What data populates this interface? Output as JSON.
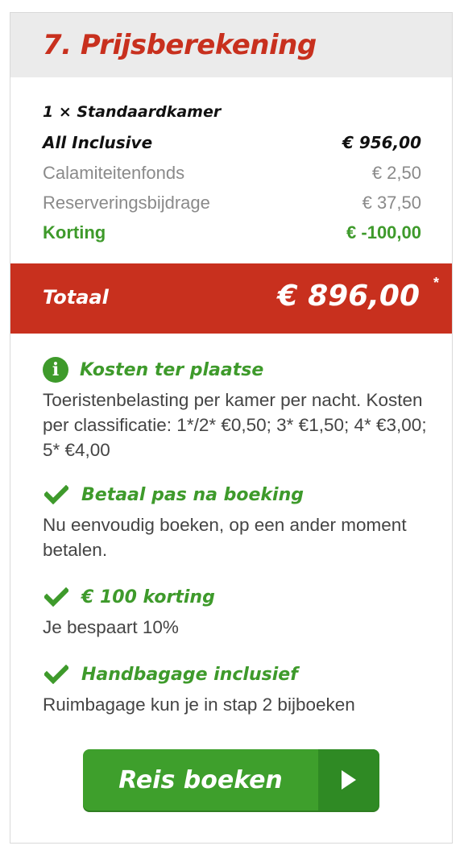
{
  "header": {
    "title": "7. Prijsberekening"
  },
  "price_lines": {
    "room": {
      "label": "1 × Standaardkamer"
    },
    "board": {
      "label": "All Inclusive",
      "value": "€ 956,00"
    },
    "fund": {
      "label": "Calamiteitenfonds",
      "value": "€ 2,50"
    },
    "reservation": {
      "label": "Reserveringsbijdrage",
      "value": "€ 37,50"
    },
    "discount": {
      "label": "Korting",
      "value": "€ -100,00"
    }
  },
  "total": {
    "label": "Totaal",
    "value": "€ 896,00",
    "marker": "*"
  },
  "info_items": [
    {
      "icon": "info-icon",
      "title": "Kosten ter plaatse",
      "text": "Toeristenbelasting per kamer per nacht. Kosten per classificatie: 1*/2* €0,50; 3* €1,50; 4* €3,00; 5* €4,00"
    },
    {
      "icon": "check-icon",
      "title": "Betaal pas na boeking",
      "text": "Nu eenvoudig boeken, op een ander moment betalen."
    },
    {
      "icon": "check-icon",
      "title": "€ 100 korting",
      "text": "Je bespaart 10%"
    },
    {
      "icon": "check-icon",
      "title": "Handbagage inclusief",
      "text": "Ruimbagage kun je in stap 2 bijboeken"
    }
  ],
  "cta": {
    "label": "Reis boeken",
    "icon": "play-arrow-icon"
  },
  "colors": {
    "brand_red": "#c8301e",
    "accent_green": "#3e9a2b",
    "muted_grey": "#8a8a8a"
  }
}
